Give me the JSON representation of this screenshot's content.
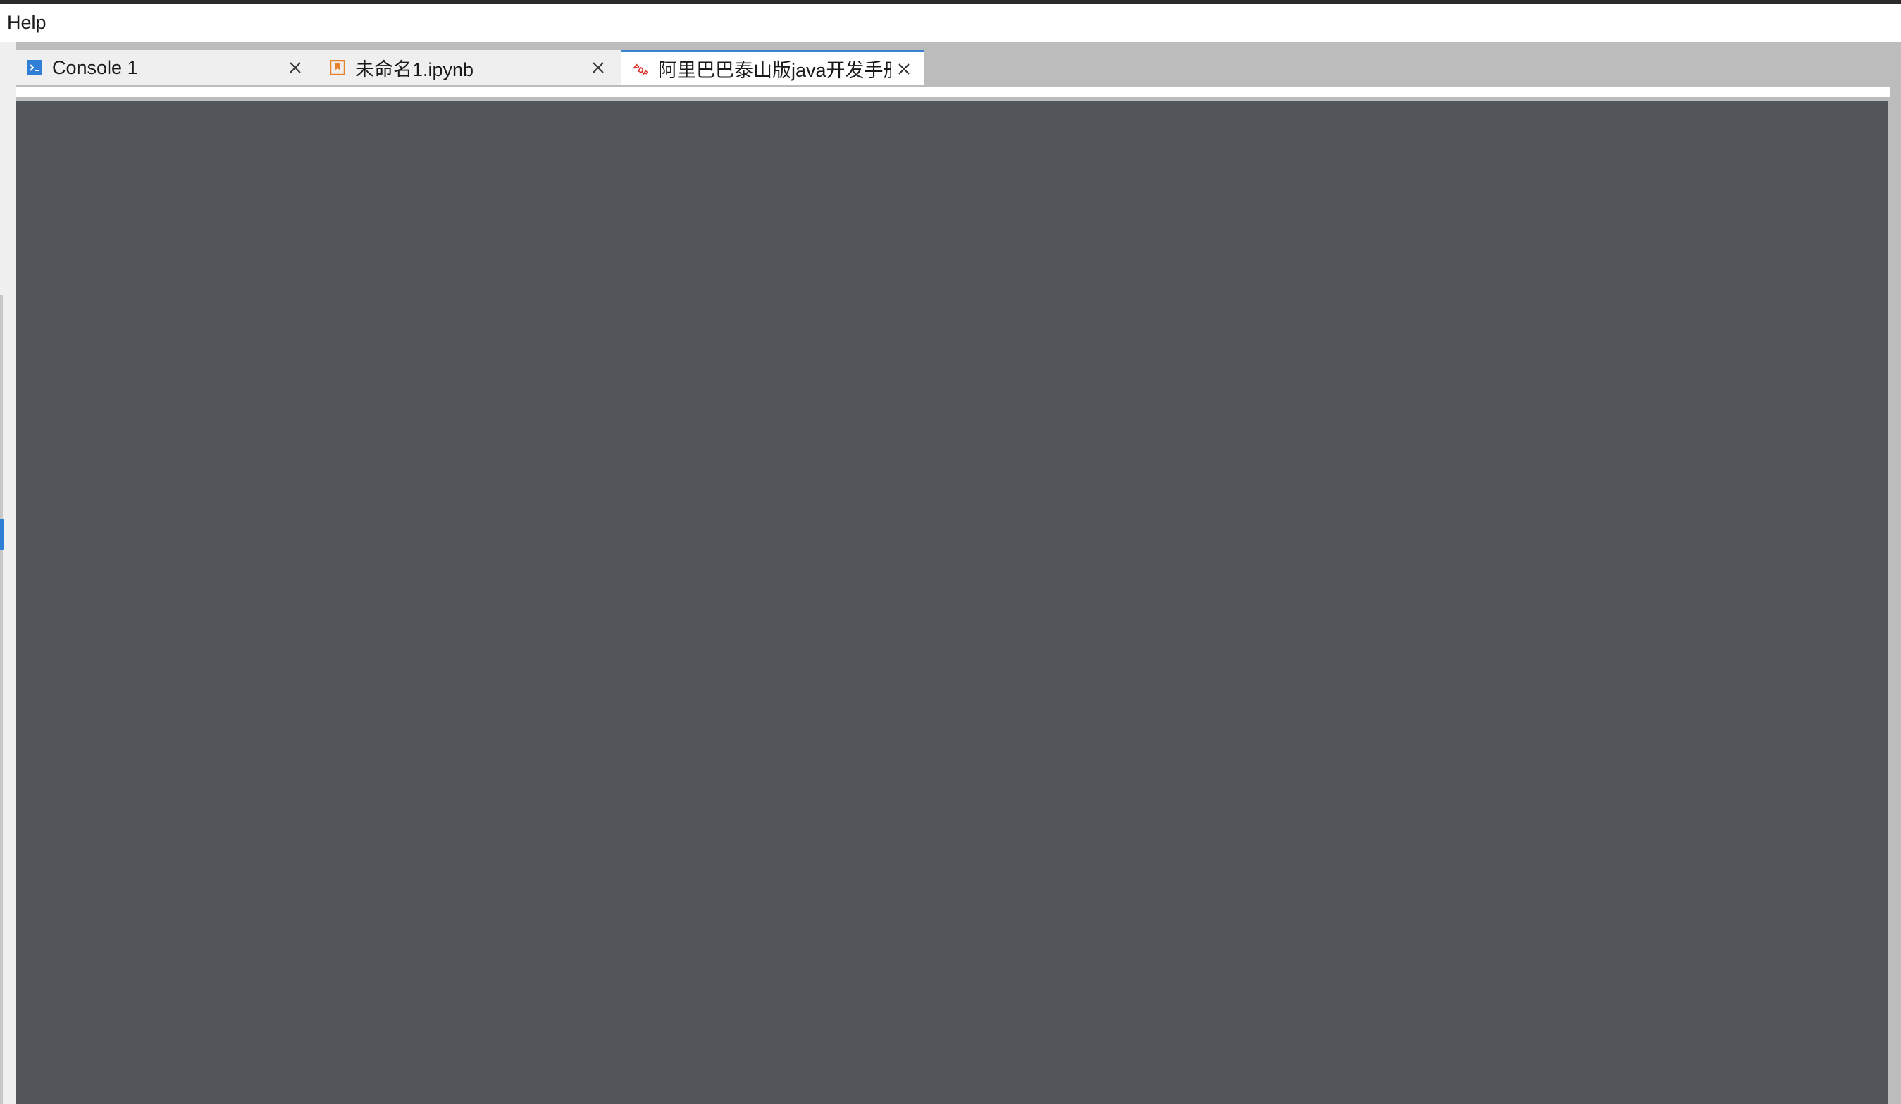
{
  "menubar": {
    "items": [
      {
        "label": "Help"
      }
    ]
  },
  "tabs": [
    {
      "label": "Console 1",
      "icon": "terminal-icon",
      "active": false
    },
    {
      "label": "未命名1.ipynb",
      "icon": "notebook-icon",
      "active": false
    },
    {
      "label": "阿里巴巴泰山版java开发手册",
      "icon": "pdf-icon",
      "active": true
    }
  ],
  "colors": {
    "active_tab_accent": "#3b82d4",
    "viewer_background": "#53575b",
    "terminal_icon": "#2f7fd6",
    "notebook_icon": "#e8822a",
    "pdf_icon": "#d93025"
  }
}
